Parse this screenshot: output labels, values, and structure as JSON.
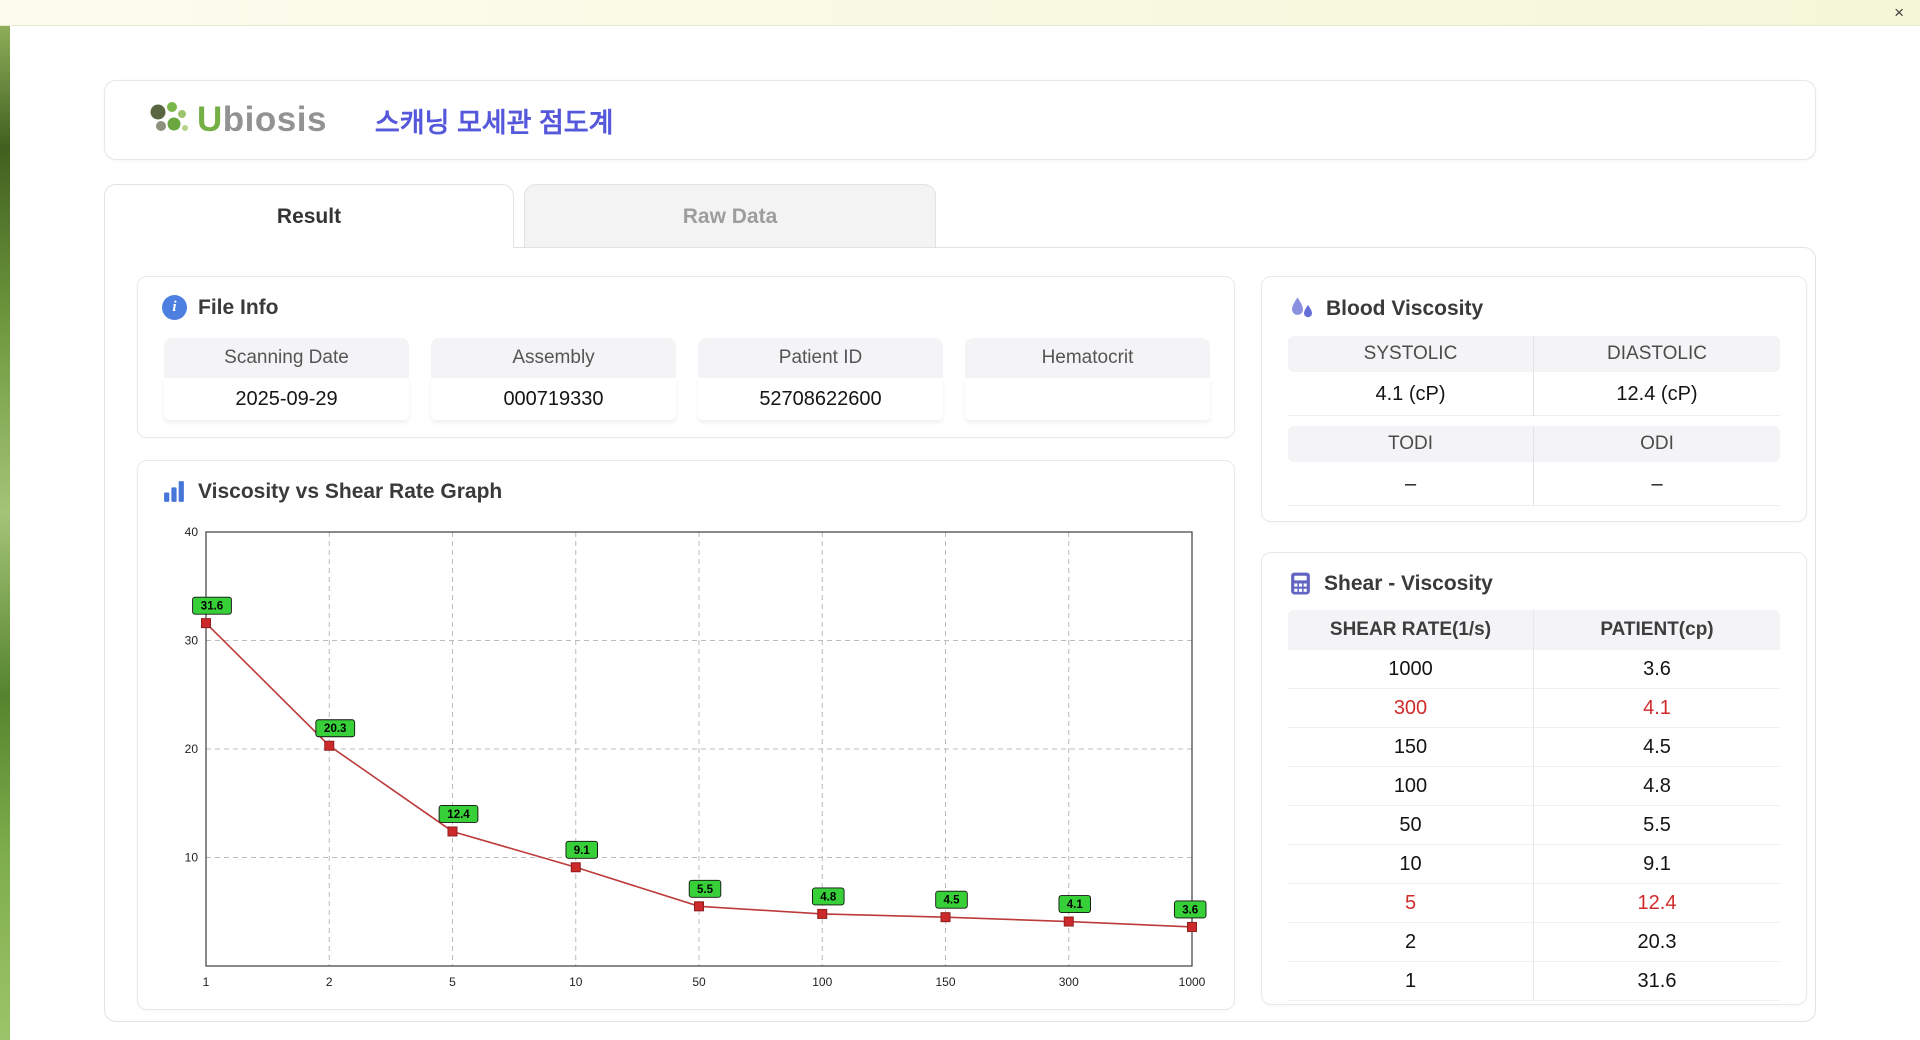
{
  "titlebar": {
    "close": "×"
  },
  "header": {
    "logo_u": "U",
    "logo_rest": "biosis",
    "app_title": "스캐닝 모세관 점도계"
  },
  "tabs": {
    "result": "Result",
    "raw_data": "Raw Data"
  },
  "file_info": {
    "title": "File Info",
    "fields": [
      {
        "label": "Scanning Date",
        "value": "2025-09-29"
      },
      {
        "label": "Assembly",
        "value": "000719330"
      },
      {
        "label": "Patient ID",
        "value": "52708622600"
      },
      {
        "label": "Hematocrit",
        "value": ""
      }
    ]
  },
  "blood_viscosity": {
    "title": "Blood Viscosity",
    "rows": [
      {
        "headers": [
          "SYSTOLIC",
          "DIASTOLIC"
        ],
        "values": [
          "4.1 (cP)",
          "12.4 (cP)"
        ]
      },
      {
        "headers": [
          "TODI",
          "ODI"
        ],
        "values": [
          "–",
          "–"
        ]
      }
    ]
  },
  "graph": {
    "title": "Viscosity vs Shear Rate Graph"
  },
  "chart_data": {
    "type": "line",
    "title": "Viscosity vs Shear Rate Graph",
    "x_categories": [
      "1",
      "2",
      "5",
      "10",
      "50",
      "100",
      "150",
      "300",
      "1000"
    ],
    "values": [
      31.6,
      20.3,
      12.4,
      9.1,
      5.5,
      4.8,
      4.5,
      4.1,
      3.6
    ],
    "point_labels": [
      "31.6",
      "20.3",
      "12.4",
      "9.1",
      "5.5",
      "4.8",
      "4.5",
      "4.1",
      "3.6"
    ],
    "y_ticks": [
      10,
      20,
      30,
      40
    ],
    "ylim": [
      0,
      40
    ],
    "x_scale": "log-ticks-evenly-spaced",
    "grid": true,
    "xlabel": "",
    "ylabel": "",
    "line_color": "#bd3b3b",
    "marker_color": "#cc2a2a",
    "label_bg": "#38d038"
  },
  "shear_viscosity": {
    "title": "Shear - Viscosity",
    "headers": [
      "SHEAR RATE(1/s)",
      "PATIENT(cp)"
    ],
    "rows": [
      {
        "rate": "1000",
        "patient": "3.6",
        "highlight": false
      },
      {
        "rate": "300",
        "patient": "4.1",
        "highlight": true
      },
      {
        "rate": "150",
        "patient": "4.5",
        "highlight": false
      },
      {
        "rate": "100",
        "patient": "4.8",
        "highlight": false
      },
      {
        "rate": "50",
        "patient": "5.5",
        "highlight": false
      },
      {
        "rate": "10",
        "patient": "9.1",
        "highlight": false
      },
      {
        "rate": "5",
        "patient": "12.4",
        "highlight": true
      },
      {
        "rate": "2",
        "patient": "20.3",
        "highlight": false
      },
      {
        "rate": "1",
        "patient": "31.6",
        "highlight": false
      }
    ]
  }
}
